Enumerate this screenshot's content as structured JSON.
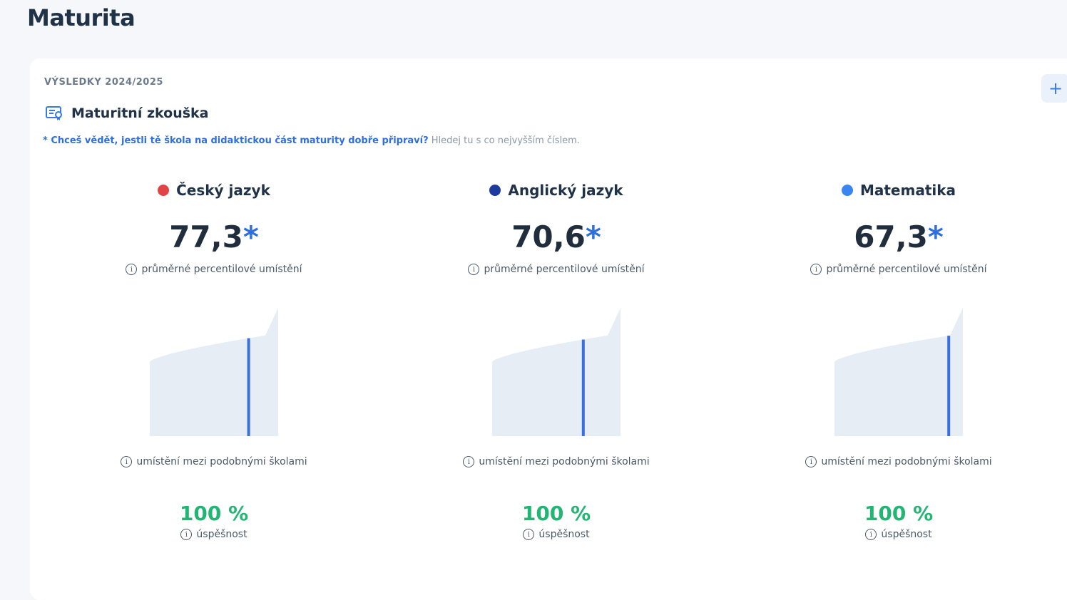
{
  "page": {
    "title": "Maturita"
  },
  "card": {
    "year_label": "VÝSLEDKY 2024/2025",
    "expand_label": "+",
    "section_title": "Maturitní zkouška",
    "hint_link": "* Chceš vědět, jestli tě škola na didaktickou část maturity dobře připraví?",
    "hint_rest": " Hledej tu s co nejvyšším číslem."
  },
  "subjects": [
    {
      "name": "Český jazyk",
      "dot_color": "#e04444",
      "score": "77,3",
      "star": "*",
      "score_caption": "průměrné percentilové umístění",
      "ranking_caption": "umístění mezi podobnými školami",
      "ranking_percentile": 0.77,
      "success": "100 %",
      "success_caption": "úspěšnost"
    },
    {
      "name": "Anglický jazyk",
      "dot_color": "#1f3a9e",
      "score": "70,6",
      "star": "*",
      "score_caption": "průměrné percentilové umístění",
      "ranking_caption": "umístění mezi podobnými školami",
      "ranking_percentile": 0.71,
      "success": "100 %",
      "success_caption": "úspěšnost"
    },
    {
      "name": "Matematika",
      "dot_color": "#3a86f0",
      "score": "67,3",
      "star": "*",
      "score_caption": "průměrné percentilové umístění",
      "ranking_caption": "umístění mezi podobnými školami",
      "ranking_percentile": 0.89,
      "success": "100 %",
      "success_caption": "úspěšnost"
    }
  ],
  "icons": {
    "info": "info-icon",
    "exam": "exam-icon"
  },
  "colors": {
    "marker": "#3a6fe0",
    "distribution": "#e6edf5",
    "success": "#22b573",
    "link": "#2f6fdc"
  }
}
